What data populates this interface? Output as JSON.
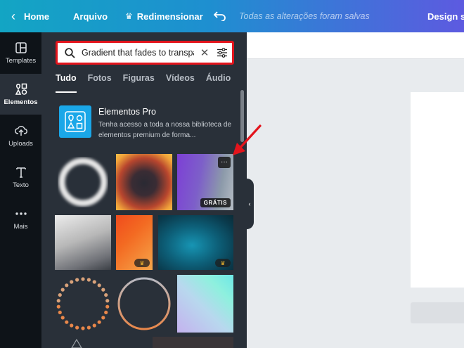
{
  "topbar": {
    "home": "Home",
    "file": "Arquivo",
    "resize": "Redimensionar",
    "saved_status": "Todas as alterações foram salvas",
    "design_title": "Design se"
  },
  "rail": {
    "items": [
      {
        "label": "Templates",
        "icon": "templates-icon"
      },
      {
        "label": "Elementos",
        "icon": "elements-icon"
      },
      {
        "label": "Uploads",
        "icon": "upload-icon"
      },
      {
        "label": "Texto",
        "icon": "text-icon"
      },
      {
        "label": "Mais",
        "icon": "more-dots-icon"
      }
    ]
  },
  "search": {
    "value": "Gradient that fades to transpa"
  },
  "tabs": [
    "Tudo",
    "Fotos",
    "Figuras",
    "Vídeos",
    "Áudio"
  ],
  "pro": {
    "title": "Elementos Pro",
    "description": "Tenha acesso a toda a nossa biblioteca de elementos premium de forma..."
  },
  "badges": {
    "free": "GRÁTIS",
    "more": "···"
  },
  "colors": {
    "accent_red": "#e3141c",
    "pro_blue": "#1aa7e8",
    "panel_bg": "#293039",
    "rail_bg": "#0e1318"
  }
}
